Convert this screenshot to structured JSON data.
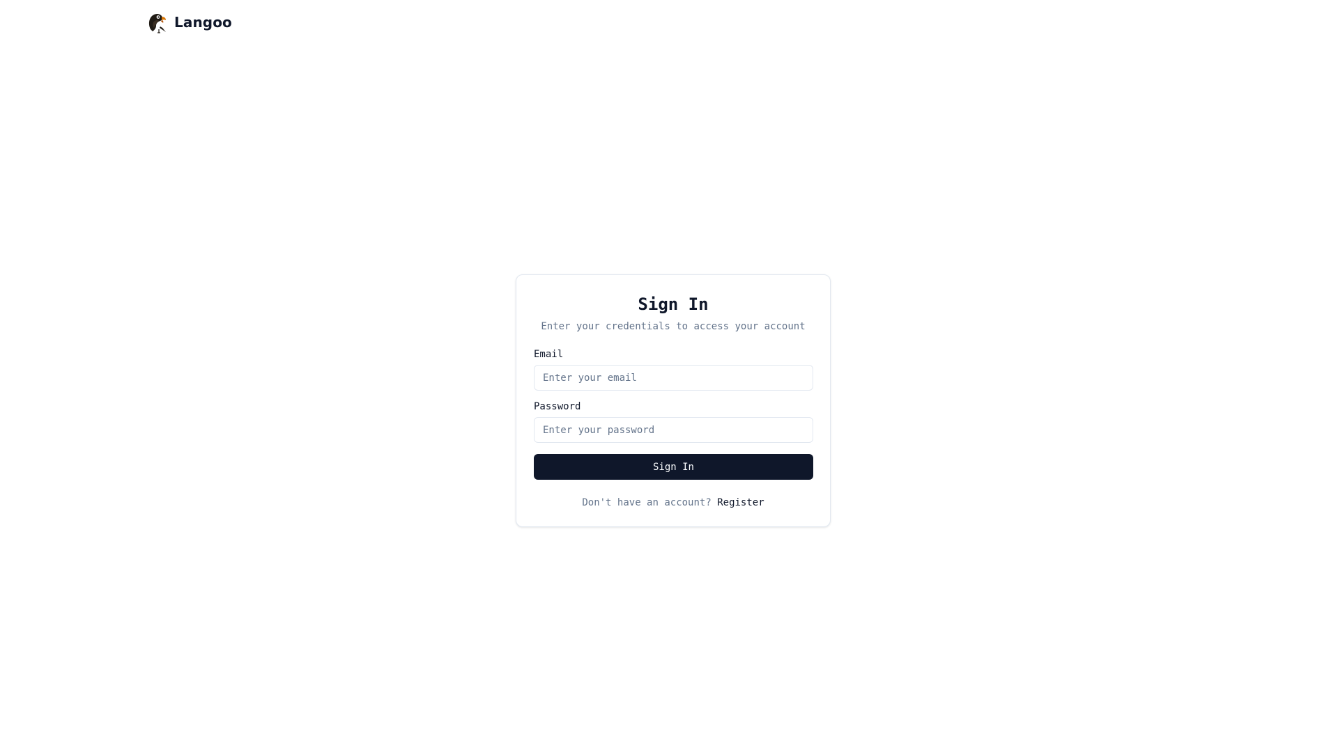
{
  "brand": {
    "name": "Langoo",
    "logo_icon": "parrot-logo-icon"
  },
  "signin": {
    "title": "Sign In",
    "subtitle": "Enter your credentials to access your account",
    "email_label": "Email",
    "email_placeholder": "Enter your email",
    "email_value": "",
    "password_label": "Password",
    "password_placeholder": "Enter your password",
    "password_value": "",
    "submit_label": "Sign In",
    "register_prompt": "Don't have an account?",
    "register_link": "Register"
  },
  "colors": {
    "primary": "#0f172a",
    "muted_text": "#64748b",
    "border": "#e2e8f0",
    "background": "#ffffff",
    "button_text": "#f8fafc"
  }
}
